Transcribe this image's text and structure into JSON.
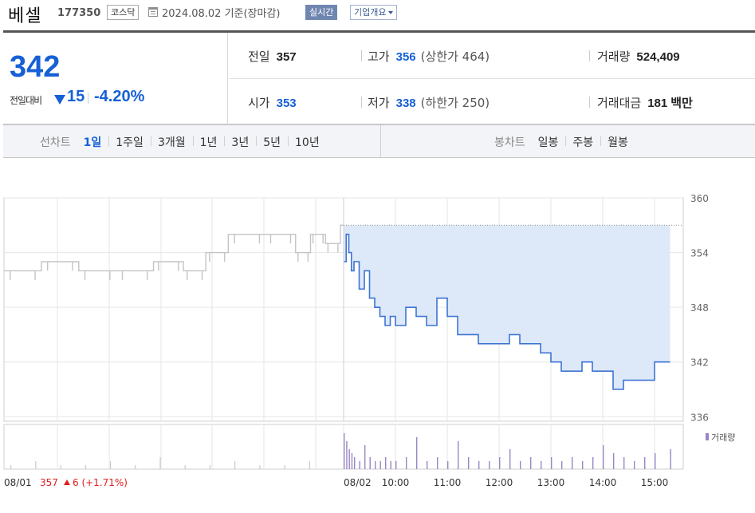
{
  "header": {
    "stock_name": "베셀",
    "stock_code": "177350",
    "market": "코스닥",
    "date_text": "2024.08.02 기준(장마감)",
    "realtime_label": "실시간",
    "company_button": "기업개요"
  },
  "price": {
    "current": "342",
    "change_label": "전일대비",
    "change": "15",
    "change_pct": "-4.20%",
    "direction": "down"
  },
  "stats": {
    "prev_close_label": "전일",
    "prev_close": "357",
    "high_label": "고가",
    "high": "356",
    "upper_limit": "(상한가 464)",
    "volume_label": "거래량",
    "volume": "524,409",
    "open_label": "시가",
    "open": "353",
    "low_label": "저가",
    "low": "338",
    "lower_limit": "(하한가 250)",
    "amount_label": "거래대금",
    "amount": "181",
    "amount_unit": "백만"
  },
  "tabs": {
    "line_title": "선차트",
    "line_periods": [
      "1일",
      "1주일",
      "3개월",
      "1년",
      "3년",
      "5년",
      "10년"
    ],
    "active_period": "1일",
    "candle_title": "봉차트",
    "candle_periods": [
      "일봉",
      "주봉",
      "월봉"
    ]
  },
  "colors": {
    "down": "#1660d6",
    "up": "#e02020",
    "today_line": "#3d74d3",
    "today_fill": "#dde9f8",
    "prev_line": "#c4c4c4",
    "volume_bar": "#9a86c4"
  },
  "chart_data": {
    "type": "line",
    "y_axis": {
      "min": 335.5,
      "max": 360,
      "ticks": [
        336,
        342,
        348,
        354,
        360
      ],
      "position": "right"
    },
    "reference_price": 357,
    "x_labels": [
      "08/01",
      "08/02",
      "10:00",
      "11:00",
      "12:00",
      "13:00",
      "14:00",
      "15:00"
    ],
    "prev_day_label": "08/01",
    "prev_day_summary": "357",
    "prev_day_change": "6 (+1.71%)",
    "volume_legend": "거래량",
    "prev_day_series": {
      "x": [
        0,
        10,
        20,
        30,
        40,
        48,
        54,
        60,
        70,
        78,
        82,
        86,
        90
      ],
      "y": [
        352,
        353,
        352,
        352,
        353,
        352,
        354,
        356,
        356,
        354,
        356,
        355,
        357
      ]
    },
    "today_series": {
      "x": [
        9.0,
        9.05,
        9.1,
        9.15,
        9.2,
        9.3,
        9.4,
        9.5,
        9.6,
        9.7,
        9.8,
        9.9,
        10.0,
        10.2,
        10.4,
        10.6,
        10.8,
        11.0,
        11.2,
        11.4,
        11.6,
        11.8,
        12.0,
        12.2,
        12.4,
        12.6,
        12.8,
        13.0,
        13.2,
        13.4,
        13.6,
        13.8,
        14.0,
        14.2,
        14.4,
        14.6,
        14.8,
        15.0,
        15.3
      ],
      "y": [
        353,
        356,
        354,
        352,
        353,
        350,
        352,
        349,
        348,
        347,
        346,
        347,
        346,
        348,
        347,
        346,
        349,
        347,
        345,
        345,
        344,
        344,
        344,
        345,
        344,
        344,
        343,
        342,
        341,
        341,
        342,
        341,
        341,
        339,
        340,
        340,
        340,
        342,
        342
      ]
    },
    "volume_prev": [
      1,
      2,
      1,
      1,
      2,
      1,
      3,
      1,
      1,
      2,
      1,
      1,
      2
    ],
    "volume_today": [
      9,
      7,
      5,
      4,
      3,
      2,
      6,
      3,
      2,
      2,
      3,
      2,
      2,
      3,
      8,
      2,
      3,
      2,
      7,
      3,
      2,
      2,
      3,
      5,
      2,
      3,
      2,
      3,
      2,
      3,
      2,
      3,
      6,
      4,
      3,
      2,
      3,
      4,
      5
    ]
  }
}
